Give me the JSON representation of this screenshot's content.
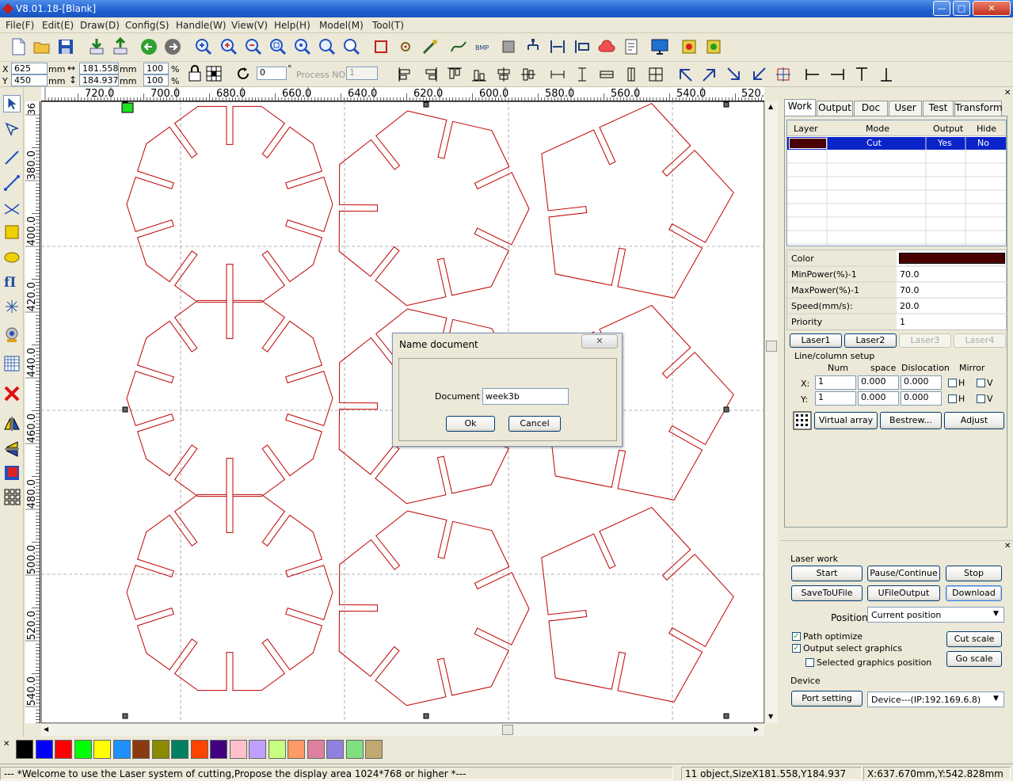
{
  "window": {
    "title": "V8.01.18-[Blank]",
    "min": "—",
    "max": "□",
    "close": "✕"
  },
  "menu": [
    "File(F)",
    "Edit(E)",
    "Draw(D)",
    "Config(S)",
    "Handle(W)",
    "View(V)",
    "Help(H)",
    "Model(M)",
    "Tool(T)"
  ],
  "toolbar2": {
    "x_label": "X",
    "x_value": "625",
    "y_label": "Y",
    "y_value": "450",
    "mm": "mm",
    "w_value": "181.558",
    "h_value": "184.937",
    "sx_value": "100",
    "sy_value": "100",
    "percent": "%",
    "rotate_value": "0",
    "degree": "°",
    "process_label": "Process NO:",
    "process_value": "1"
  },
  "ruler": {
    "h_labels": [
      "720.0",
      "700.0",
      "680.0",
      "660.0",
      "640.0",
      "620.0",
      "600.0",
      "580.0",
      "560.0",
      "540.0",
      "520.0"
    ],
    "v_labels": [
      "380.0",
      "400.0",
      "420.0",
      "440.0",
      "460.0",
      "480.0",
      "500.0",
      "520.0",
      "540.0"
    ],
    "v_top": "36"
  },
  "tabs": [
    "Work",
    "Output",
    "Doc",
    "User",
    "Test",
    "Transform"
  ],
  "layer_table": {
    "headers": [
      "Layer",
      "Mode",
      "Output",
      "Hide"
    ],
    "row": {
      "mode": "Cut",
      "output": "Yes",
      "hide": "No"
    },
    "layer_color": "#4a0000"
  },
  "props": [
    {
      "label": "Color",
      "value": ""
    },
    {
      "label": "MinPower(%)-1",
      "value": "70.0"
    },
    {
      "label": "MaxPower(%)-1",
      "value": "70.0"
    },
    {
      "label": "Speed(mm/s):",
      "value": "20.0"
    },
    {
      "label": "Priority",
      "value": "1"
    }
  ],
  "laser_tabs": [
    "Laser1",
    "Laser2",
    "Laser3",
    "Laser4"
  ],
  "line_setup": {
    "title": "Line/column setup",
    "headers": [
      "Num",
      "space",
      "Dislocation",
      "Mirror"
    ],
    "x_label": "X:",
    "y_label": "Y:",
    "x": {
      "num": "1",
      "space": "0.000",
      "disl": "0.000"
    },
    "y": {
      "num": "1",
      "space": "0.000",
      "disl": "0.000"
    },
    "h": "H",
    "v": "V",
    "virtual_array": "Virtual array",
    "bestrew": "Bestrew...",
    "adjust": "Adjust"
  },
  "laser_work": {
    "title": "Laser work",
    "start": "Start",
    "pause": "Pause/Continue",
    "stop": "Stop",
    "save": "SaveToUFile",
    "ufile": "UFileOutput",
    "download": "Download",
    "position_label": "Position:",
    "position_value": "Current position",
    "path_optimize": "Path optimize",
    "output_select": "Output select graphics",
    "selected_pos": "Selected graphics position",
    "cut_scale": "Cut scale",
    "go_scale": "Go scale",
    "device_title": "Device",
    "port_setting": "Port setting",
    "device_value": "Device---(IP:192.169.6.8)"
  },
  "dialog": {
    "title": "Name document",
    "label": "Document",
    "value": "week3b",
    "ok": "Ok",
    "cancel": "Cancel"
  },
  "palette_colors": [
    "#000000",
    "#0000ff",
    "#ff0000",
    "#00ff00",
    "#ffff00",
    "#1e90ff",
    "#8b3a0f",
    "#8b8b00",
    "#008060",
    "#ff4500",
    "#400080",
    "#ffc0cb",
    "#c0a0ff",
    "#c8ff80",
    "#ff9966",
    "#e080a0",
    "#9080e0",
    "#80e080",
    "#c0a870"
  ],
  "status": {
    "welcome": "--- *Welcome to use the Laser system of cutting,Propose the display area 1024*768 or higher *---",
    "objects": "11 object,SizeX181.558,Y184.937",
    "coords": "X:637.670mm,Y:542.828mm"
  }
}
